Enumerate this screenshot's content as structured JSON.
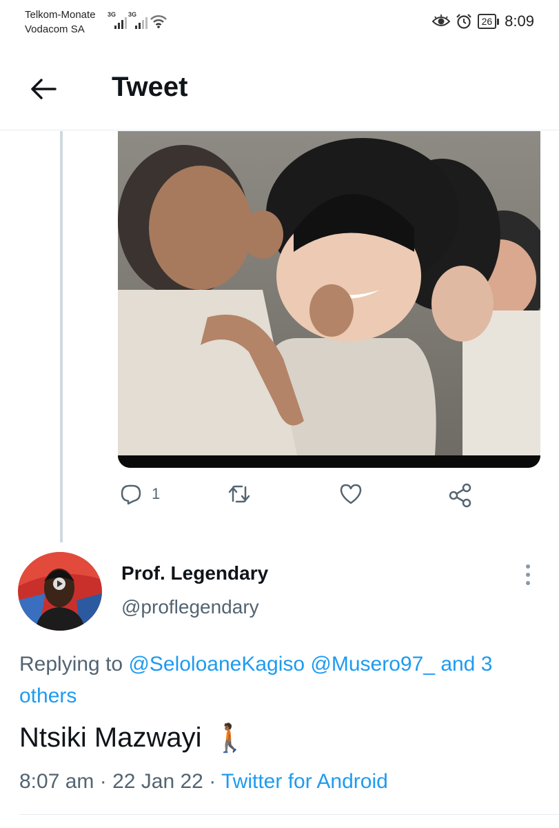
{
  "status_bar": {
    "carrier_primary": "Telkom-Monate",
    "carrier_secondary": "Vodacom SA",
    "network1": "3G",
    "network2": "3G",
    "battery_level": "26",
    "time": "8:09"
  },
  "header": {
    "title": "Tweet"
  },
  "actions": {
    "reply_count": "1",
    "retweet_count": "",
    "like_count": ""
  },
  "reply_tweet": {
    "display_name": "Prof. Legendary",
    "handle": "@proflegendary",
    "replying_prefix": "Replying to",
    "mention1": "@SeloloaneKagiso",
    "mention2": "@Musero97_",
    "mention_joiner": "and 3 others",
    "text": "Ntsiki Mazwayi",
    "emoji": "🚶🏾",
    "time": "8:07 am",
    "separator": "·",
    "date": "22 Jan 22",
    "source": "Twitter for Android"
  },
  "icons": {
    "back": "arrow-left-icon",
    "reply": "reply-icon",
    "retweet": "retweet-icon",
    "like": "heart-icon",
    "share": "share-icon",
    "more": "more-vertical-icon"
  },
  "colors": {
    "accent": "#1d9bf0",
    "secondary_text": "#536471",
    "primary_text": "#0f1419",
    "divider": "#e6ecf0"
  }
}
